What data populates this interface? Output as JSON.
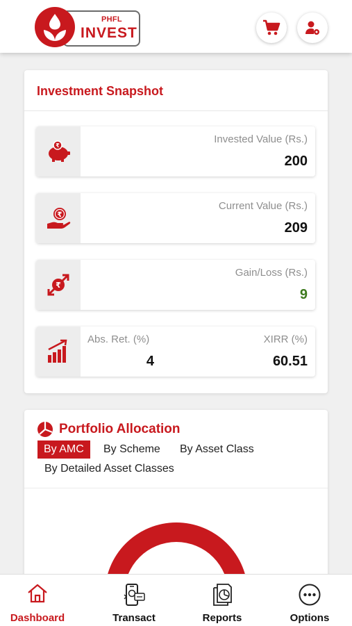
{
  "brand": {
    "phfl": "PHFL",
    "invest": "INVEST"
  },
  "snapshot": {
    "title": "Investment Snapshot",
    "invested": {
      "label": "Invested Value (Rs.)",
      "value": "200"
    },
    "current": {
      "label": "Current Value (Rs.)",
      "value": "209"
    },
    "gain": {
      "label": "Gain/Loss (Rs.)",
      "value": "9"
    },
    "abs_ret": {
      "label": "Abs. Ret. (%)",
      "value": "4"
    },
    "xirr": {
      "label": "XIRR (%)",
      "value": "60.51"
    }
  },
  "portfolio": {
    "title": "Portfolio Allocation",
    "tabs": [
      "By AMC",
      "By Scheme",
      "By Asset Class",
      "By Detailed Asset Classes"
    ],
    "active_tab": "By AMC"
  },
  "nav": {
    "items": [
      {
        "label": "Dashboard",
        "icon": "home-icon"
      },
      {
        "label": "Transact",
        "icon": "phone-transfer-icon"
      },
      {
        "label": "Reports",
        "icon": "report-icon"
      },
      {
        "label": "Options",
        "icon": "more-icon"
      }
    ],
    "active": "Dashboard"
  },
  "colors": {
    "brand_red": "#c8191e",
    "gain_green": "#3d7a1e",
    "muted_gray": "#8e8e8e"
  }
}
